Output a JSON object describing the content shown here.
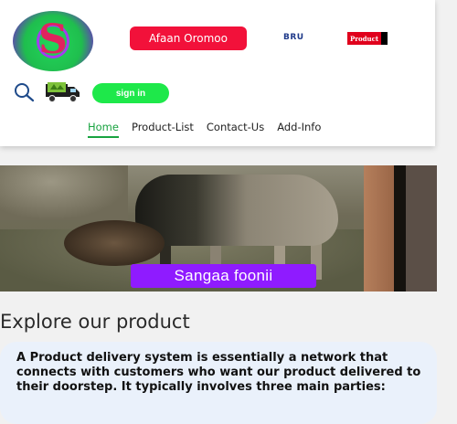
{
  "header": {
    "logo_glyph": "S",
    "language_button": "Afaan Oromoo",
    "bru_label": "BRU",
    "product_flag": "Product",
    "signin_button": "sign in"
  },
  "nav": {
    "items": [
      "Home",
      "Product-List",
      "Contact-Us",
      "Add-Info"
    ],
    "active": "Home"
  },
  "hero": {
    "caption": "Sangaa foonii"
  },
  "main": {
    "section_title": "Explore our product",
    "description": "A Product delivery system is essentially a network that connects with customers who want our product delivered to their doorstep. It typically involves three main parties:"
  },
  "colors": {
    "accent_green": "#18a340",
    "language_red": "#f2113a",
    "caption_purple": "#8f1bff",
    "signin_green": "#1ee84a"
  },
  "icons": [
    "search-icon",
    "delivery-truck-icon"
  ]
}
